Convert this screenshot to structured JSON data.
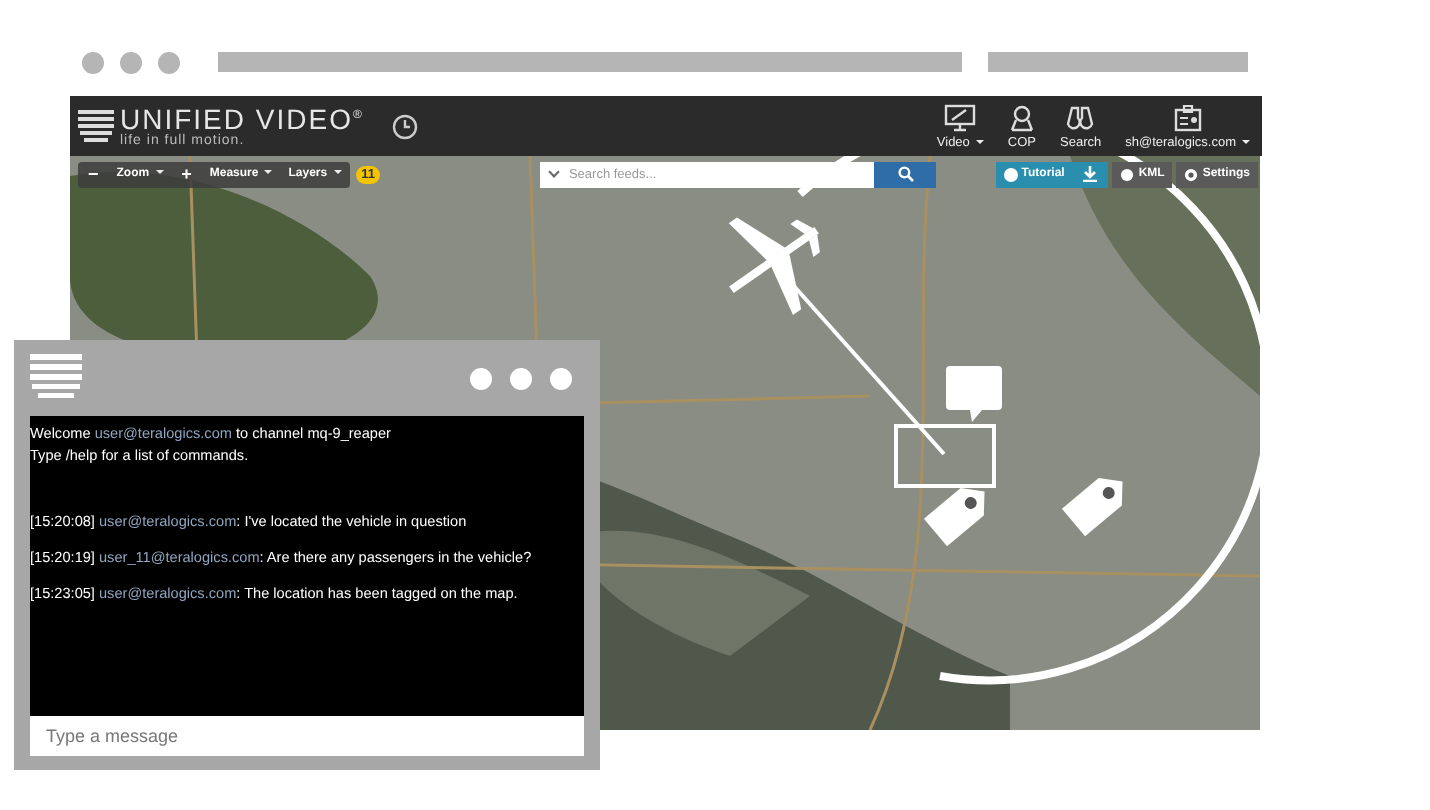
{
  "header": {
    "title": "UNIFIED VIDEO$^{®}$",
    "tagline": "life in full motion.",
    "nav": [
      {
        "label": "Video",
        "has_menu": true
      },
      {
        "label": "COP",
        "has_menu": false
      },
      {
        "label": "Search",
        "has_menu": false
      },
      {
        "label": "sh@teralogics.com",
        "has_menu": true
      }
    ]
  },
  "toolbar": {
    "left": [
      {
        "kind": "icon",
        "label": "−"
      },
      {
        "kind": "menu",
        "label": "Zoom"
      },
      {
        "kind": "icon",
        "label": "+"
      },
      {
        "kind": "menu",
        "label": "Measure"
      },
      {
        "kind": "menu",
        "label": "Layers"
      }
    ],
    "badge": "11",
    "search": {
      "placeholder": "Search feeds..."
    },
    "right": [
      {
        "kind": "tutorial",
        "label": "Tutorial"
      },
      {
        "kind": "download"
      },
      {
        "kind": "plain",
        "label": "KML"
      },
      {
        "kind": "plain",
        "label": "Settings"
      }
    ]
  },
  "chat": {
    "welcome": {
      "before": "Welcome ",
      "user": "user@teralogics.com",
      "after": " to channel mq-9_reaper"
    },
    "help": "Type /help for a list of commands.",
    "messages": [
      {
        "time": "[15:20:08]",
        "user": "user@teralogics.com",
        "text": ": I've located the vehicle in question"
      },
      {
        "time": "[15:20:19]",
        "user": "user_11@teralogics.com",
        "text": ": Are there any passengers in the vehicle?"
      },
      {
        "time": "[15:23:05]",
        "user": "user@teralogics.com",
        "text": ": The location has been tagged on the map."
      }
    ],
    "input": {
      "placeholder": "Type a message"
    }
  }
}
